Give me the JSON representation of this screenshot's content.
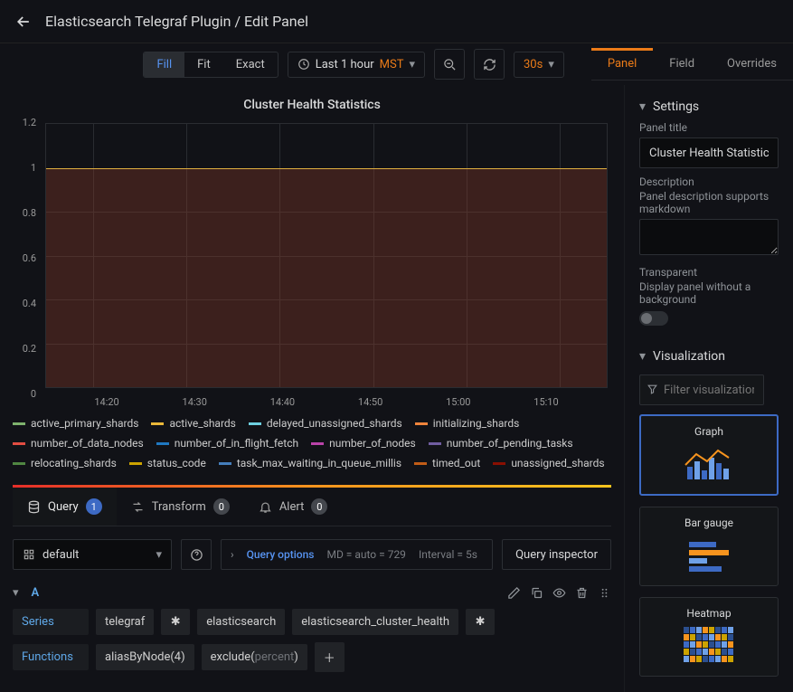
{
  "breadcrumb": "Elasticsearch Telegraf Plugin / Edit Panel",
  "fitmodes": {
    "fill": "Fill",
    "fit": "Fit",
    "exact": "Exact"
  },
  "timerange": {
    "label": "Last 1 hour",
    "tz": "MST"
  },
  "refresh": "30s",
  "rtabs": {
    "panel": "Panel",
    "field": "Field",
    "overrides": "Overrides"
  },
  "settings": {
    "heading": "Settings",
    "title_label": "Panel title",
    "title_value": "Cluster Health Statistics",
    "desc_label": "Description",
    "desc_hint": "Panel description supports markdown",
    "transparent_label": "Transparent",
    "transparent_hint": "Display panel without a background"
  },
  "viz": {
    "heading": "Visualization",
    "filter_ph": "Filter visualizations",
    "cards": {
      "graph": "Graph",
      "bargauge": "Bar gauge",
      "heatmap": "Heatmap"
    }
  },
  "lowtabs": {
    "query": "Query",
    "query_n": "1",
    "transform": "Transform",
    "transform_n": "0",
    "alert": "Alert",
    "alert_n": "0"
  },
  "datasrc": "default",
  "qopts": {
    "link": "Query options",
    "md": "MD = auto = 729",
    "intv": "Interval = 5s"
  },
  "qins": "Query inspector",
  "query": {
    "id": "A",
    "series_label": "Series",
    "series": [
      "telegraf",
      "elasticsearch",
      "elasticsearch_cluster_health"
    ],
    "func_label": "Functions",
    "funcs": [
      "aliasByNode(4)"
    ],
    "exclude_prefix": "exclude(",
    "exclude_arg": "percent",
    "exclude_suffix": ")"
  },
  "panel_title": "Cluster Health Statistics",
  "chart_data": {
    "type": "area",
    "title": "Cluster Health Statistics",
    "xlabel": "",
    "ylabel": "",
    "ylim": [
      0,
      1.2
    ],
    "yticks": [
      0,
      0.2,
      0.4,
      0.6,
      0.8,
      1.0,
      1.2
    ],
    "xticks": [
      "14:20",
      "14:30",
      "14:40",
      "14:50",
      "15:00",
      "15:10"
    ],
    "x_range": [
      "14:12",
      "15:12"
    ],
    "series": [
      {
        "name": "active_primary_shards",
        "color": "#7eb26d",
        "const_value": 1.0
      },
      {
        "name": "active_shards",
        "color": "#eab839",
        "const_value": 1.0
      },
      {
        "name": "delayed_unassigned_shards",
        "color": "#6ed0e0",
        "const_value": 0
      },
      {
        "name": "initializing_shards",
        "color": "#ef843c",
        "const_value": 0
      },
      {
        "name": "number_of_data_nodes",
        "color": "#e24d42",
        "const_value": 1.0
      },
      {
        "name": "number_of_in_flight_fetch",
        "color": "#1f78c1",
        "const_value": 0
      },
      {
        "name": "number_of_nodes",
        "color": "#ba43a9",
        "const_value": 1.0
      },
      {
        "name": "number_of_pending_tasks",
        "color": "#705da0",
        "const_value": 0
      },
      {
        "name": "relocating_shards",
        "color": "#508642",
        "const_value": 0
      },
      {
        "name": "status_code",
        "color": "#cca300",
        "const_value": 1.0
      },
      {
        "name": "task_max_waiting_in_queue_millis",
        "color": "#447ebc",
        "const_value": 0
      },
      {
        "name": "timed_out",
        "color": "#c15c17",
        "const_value": 0
      },
      {
        "name": "unassigned_shards",
        "color": "#890f02",
        "const_value": 0
      }
    ]
  }
}
